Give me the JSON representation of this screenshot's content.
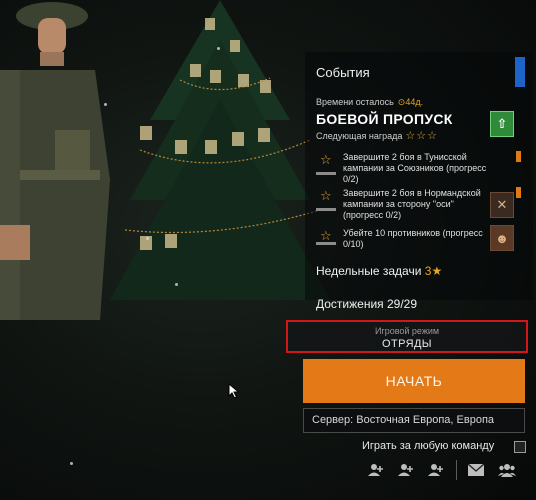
{
  "events": {
    "title": "События",
    "accent_color": "#1e63c8"
  },
  "battle_pass": {
    "time_left_label": "Времени осталось",
    "time_left_value": "⊙44д.",
    "title": "БОЕВОЙ ПРОПУСК",
    "next_reward_label": "Следующая награда",
    "next_reward_stars": "☆☆☆",
    "reward_icon": "arrow-up-icon"
  },
  "tasks": [
    {
      "text": "Завершите 2 боя в Тунисской кампании за Союзников (прогресс 0/2)",
      "star": "☆",
      "icon": "none"
    },
    {
      "text": "Завершите 2 боя в Нормандской кампании за сторону \"оси\" (прогресс 0/2)",
      "star": "☆",
      "icon": "crossed-rifles-icon"
    },
    {
      "text": "Убейте 10 противников (прогресс 0/10)",
      "star": "☆",
      "icon": "soldier-icon"
    }
  ],
  "weekly": {
    "label": "Недельные задачи",
    "count": "3",
    "star": "★"
  },
  "achievements": {
    "label": "Достижения 29/29"
  },
  "game_mode": {
    "label": "Игровой режим",
    "value": "ОТРЯДЫ",
    "highlight_color": "#d01818"
  },
  "start_button": {
    "label": "НАЧАТЬ",
    "color": "#e47918"
  },
  "server": {
    "text": "Сервер: Восточная Европа, Европа"
  },
  "any_team": {
    "label": "Играть за любую команду",
    "checked": false
  },
  "bottom_icons": [
    "add-friend-icon",
    "add-friend-icon",
    "add-friend-icon",
    "mail-icon",
    "group-icon"
  ]
}
